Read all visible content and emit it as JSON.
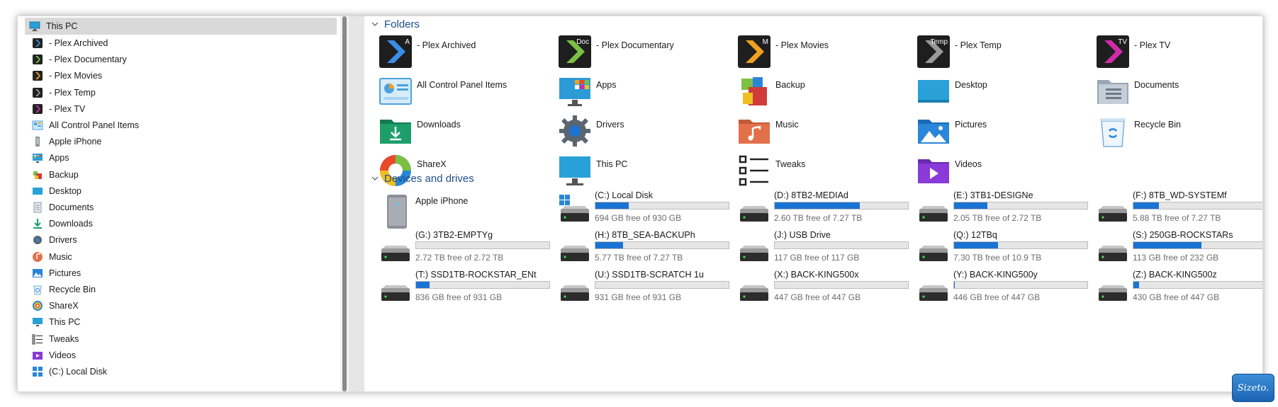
{
  "sidebar": {
    "root": "This PC",
    "items": [
      {
        "label": "- Plex Archived",
        "icon": "plex-archived-icon",
        "color": "#3a8ee8"
      },
      {
        "label": "- Plex Documentary",
        "icon": "plex-documentary-icon",
        "color": "#7bc043"
      },
      {
        "label": "- Plex Movies",
        "icon": "plex-movies-icon",
        "color": "#f0a020"
      },
      {
        "label": "- Plex Temp",
        "icon": "plex-temp-icon",
        "color": "#9a9a9a"
      },
      {
        "label": "- Plex TV",
        "icon": "plex-tv-icon",
        "color": "#d12ca8"
      },
      {
        "label": "All Control Panel Items",
        "icon": "control-panel-icon",
        "color": "#4aa3e0"
      },
      {
        "label": "Apple iPhone",
        "icon": "phone-icon",
        "color": "#8a8f99"
      },
      {
        "label": "Apps",
        "icon": "apps-icon",
        "color": "#2d9ad8"
      },
      {
        "label": "Backup",
        "icon": "backup-icon",
        "color": "#d13b3b"
      },
      {
        "label": "Desktop",
        "icon": "desktop-icon",
        "color": "#2aa0d8"
      },
      {
        "label": "Documents",
        "icon": "documents-icon",
        "color": "#8a98a8"
      },
      {
        "label": "Downloads",
        "icon": "downloads-icon",
        "color": "#1e9e6a"
      },
      {
        "label": "Drivers",
        "icon": "gear-icon",
        "color": "#5a6570"
      },
      {
        "label": "Music",
        "icon": "music-icon",
        "color": "#e2704a"
      },
      {
        "label": "Pictures",
        "icon": "pictures-icon",
        "color": "#2a86d8"
      },
      {
        "label": "Recycle Bin",
        "icon": "recycle-bin-icon",
        "color": "#7ab0d8"
      },
      {
        "label": "ShareX",
        "icon": "sharex-icon",
        "color": "#e84a2a"
      },
      {
        "label": "This PC",
        "icon": "monitor-icon",
        "color": "#2aa0d8"
      },
      {
        "label": "Tweaks",
        "icon": "list-icon",
        "color": "#222222"
      },
      {
        "label": "Videos",
        "icon": "videos-icon",
        "color": "#8a3ad8"
      },
      {
        "label": "(C:) Local Disk",
        "icon": "windows-drive-icon",
        "color": "#2a86d8"
      }
    ]
  },
  "main": {
    "folders_header": "Folders",
    "devices_header": "Devices and drives",
    "folders": [
      {
        "label": "- Plex Archived",
        "icon": "plex-archived-icon",
        "tag": "A",
        "color": "#3a8ee8"
      },
      {
        "label": "- Plex Documentary",
        "icon": "plex-documentary-icon",
        "tag": "Doc",
        "color": "#7bc043"
      },
      {
        "label": "- Plex Movies",
        "icon": "plex-movies-icon",
        "tag": "M",
        "color": "#f0a020"
      },
      {
        "label": "- Plex Temp",
        "icon": "plex-temp-icon",
        "tag": "Temp",
        "color": "#9a9a9a"
      },
      {
        "label": "- Plex TV",
        "icon": "plex-tv-icon",
        "tag": "TV",
        "color": "#d12ca8"
      },
      {
        "label": "All Control Panel Items",
        "icon": "control-panel-icon",
        "color": "#4aa3e0"
      },
      {
        "label": "Apps",
        "icon": "apps-icon",
        "color": "#2d9ad8"
      },
      {
        "label": "Backup",
        "icon": "backup-icon",
        "color": "#d13b3b"
      },
      {
        "label": "Desktop",
        "icon": "desktop-icon",
        "color": "#2aa0d8"
      },
      {
        "label": "Documents",
        "icon": "documents-icon",
        "color": "#8a98a8"
      },
      {
        "label": "Downloads",
        "icon": "downloads-icon",
        "color": "#1e9e6a"
      },
      {
        "label": "Drivers",
        "icon": "gear-icon",
        "color": "#5a6570"
      },
      {
        "label": "Music",
        "icon": "music-icon",
        "color": "#e2704a"
      },
      {
        "label": "Pictures",
        "icon": "pictures-icon",
        "color": "#2a86d8"
      },
      {
        "label": "Recycle Bin",
        "icon": "recycle-bin-icon",
        "color": "#7ab0d8"
      },
      {
        "label": "ShareX",
        "icon": "sharex-icon",
        "color": "#e84a2a"
      },
      {
        "label": "This PC",
        "icon": "monitor-icon",
        "color": "#2aa0d8"
      },
      {
        "label": "Tweaks",
        "icon": "list-icon",
        "color": "#222222"
      },
      {
        "label": "Videos",
        "icon": "videos-icon",
        "color": "#8a3ad8"
      }
    ],
    "devices": [
      {
        "name": "Apple iPhone",
        "free": "",
        "used_fraction": null,
        "type": "phone"
      },
      {
        "name": "(C:) Local Disk",
        "free": "694 GB free of 930 GB",
        "used_fraction": 0.25,
        "type": "windows"
      },
      {
        "name": "(D:) 8TB2-MEDIAd",
        "free": "2.60 TB free of 7.27 TB",
        "used_fraction": 0.64,
        "type": "hdd"
      },
      {
        "name": "(E:) 3TB1-DESIGNe",
        "free": "2.05 TB free of 2.72 TB",
        "used_fraction": 0.25,
        "type": "hdd"
      },
      {
        "name": "(F:) 8TB_WD-SYSTEMf",
        "free": "5.88 TB free of 7.27 TB",
        "used_fraction": 0.19,
        "type": "hdd"
      },
      {
        "name": "(G:) 3TB2-EMPTYg",
        "free": "2.72 TB free of 2.72 TB",
        "used_fraction": 0.0,
        "type": "hdd"
      },
      {
        "name": "(H:) 8TB_SEA-BACKUPh",
        "free": "5.77 TB free of 7.27 TB",
        "used_fraction": 0.21,
        "type": "hdd"
      },
      {
        "name": "(J:) USB Drive",
        "free": "117 GB free of 117 GB",
        "used_fraction": 0.0,
        "type": "hdd"
      },
      {
        "name": "(Q:) 12TBq",
        "free": "7.30 TB free of 10.9 TB",
        "used_fraction": 0.33,
        "type": "hdd"
      },
      {
        "name": "(S:) 250GB-ROCKSTARs",
        "free": "113 GB free of 232 GB",
        "used_fraction": 0.51,
        "type": "hdd"
      },
      {
        "name": "(T:) SSD1TB-ROCKSTAR_ENt",
        "free": "836 GB free of 931 GB",
        "used_fraction": 0.1,
        "type": "hdd"
      },
      {
        "name": "(U:) SSD1TB-SCRATCH 1u",
        "free": "931 GB free of 931 GB",
        "used_fraction": 0.0,
        "type": "hdd"
      },
      {
        "name": "(X:) BACK-KING500x",
        "free": "447 GB free of 447 GB",
        "used_fraction": 0.0,
        "type": "hdd"
      },
      {
        "name": "(Y:) BACK-KING500y",
        "free": "446 GB free of 447 GB",
        "used_fraction": 0.002,
        "type": "hdd"
      },
      {
        "name": "(Z:) BACK-KING500z",
        "free": "430 GB free of 447 GB",
        "used_fraction": 0.04,
        "type": "hdd"
      }
    ]
  },
  "watermark": {
    "label": "Sizeto."
  },
  "colors": {
    "accent": "#1a73d2",
    "header": "#1f4e8c",
    "selection": "#d9d9d9"
  }
}
